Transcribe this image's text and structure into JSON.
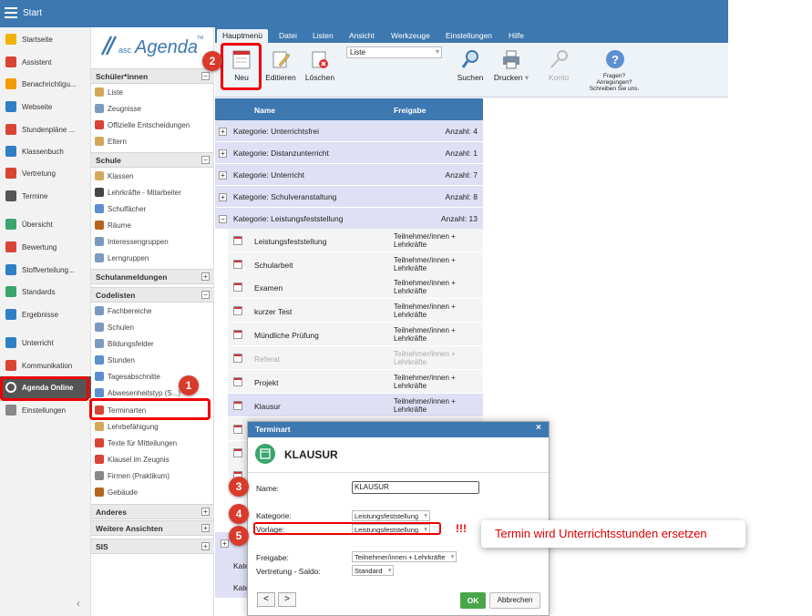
{
  "app": {
    "title": "Start"
  },
  "left_nav": [
    {
      "label": "Startseite",
      "color": "#f3b200"
    },
    {
      "label": "Assistent",
      "color": "#d94435"
    },
    {
      "label": "Benachrichtigu...",
      "color": "#f29a00"
    },
    {
      "label": "Webseite",
      "color": "#2f7fc4"
    },
    {
      "label": "Stundenpläne ...",
      "color": "#d94435"
    },
    {
      "label": "Klassenbuch",
      "color": "#2f7fc4"
    },
    {
      "label": "Vertretung",
      "color": "#d94435"
    },
    {
      "label": "Termine",
      "color": "#555555"
    },
    {
      "label": "Übersicht",
      "color": "#3aa56d"
    },
    {
      "label": "Bewertung",
      "color": "#d94435"
    },
    {
      "label": "Stoffverteilung...",
      "color": "#2f7fc4"
    },
    {
      "label": "Standards",
      "color": "#3aa56d"
    },
    {
      "label": "Ergebnisse",
      "color": "#2f7fc4"
    },
    {
      "label": "Unterricht",
      "color": "#2f7fc4"
    },
    {
      "label": "Kommunikation",
      "color": "#d94435"
    },
    {
      "label": "Agenda Online",
      "color": "#ffffff"
    },
    {
      "label": "Einstellungen",
      "color": "#888888"
    }
  ],
  "logo": {
    "text_small": "asc",
    "text_big": "Agenda",
    "tm": "TM"
  },
  "mid_nav": {
    "sections": [
      {
        "label": "Schüler*innen",
        "toggle": "⊟"
      },
      {
        "label": "Schule",
        "toggle": "⊟"
      },
      {
        "label": "Schulanmeldungen",
        "toggle": "⊞"
      },
      {
        "label": "Codelisten",
        "toggle": "⊟"
      },
      {
        "label": "Anderes",
        "toggle": "⊞"
      },
      {
        "label": "Weitere Ansichten",
        "toggle": "⊞"
      },
      {
        "label": "SIS",
        "toggle": "⊞"
      }
    ],
    "items": [
      "Liste",
      "Zeugnisse",
      "Offizielle Entscheidungen",
      "Eltern",
      "Klassen",
      "Lehrkräfte - Mitarbeiter",
      "Schulfächer",
      "Räume",
      "Interessengruppen",
      "Lerngruppen",
      "Fachbereiche",
      "Schulen",
      "Bildungsfelder",
      "Stunden",
      "Tagesabschnitte",
      "Abwesenheitstyp (S...)",
      "Terminarten",
      "Lehrbefähigung",
      "Texte für Mitteilungen",
      "Klausel im Zeugnis",
      "Firmen (Praktikum)",
      "Gebäude"
    ]
  },
  "menu": [
    "Hauptmenü",
    "Datei",
    "Listen",
    "Ansicht",
    "Werkzeuge",
    "Einstellungen",
    "Hilfe"
  ],
  "toolbar": {
    "neu": "Neu",
    "edit": "Editieren",
    "delete": "Löschen",
    "view_select": "Liste",
    "search": "Suchen",
    "print": "Drucken",
    "account": "Konto",
    "help1": "Fragen?",
    "help2": "Anregungen?",
    "help3": "Schreiben Sie uns."
  },
  "grid": {
    "col_name": "Name",
    "col_freigabe": "Freigabe",
    "categories": [
      {
        "name": "Kategorie: Unterrichtsfrei",
        "count": "Anzahl: 4",
        "ex": "+"
      },
      {
        "name": "Kategorie: Distanzunterricht",
        "count": "Anzahl: 1",
        "ex": "+"
      },
      {
        "name": "Kategorie: Unterricht",
        "count": "Anzahl: 7",
        "ex": "+"
      },
      {
        "name": "Kategorie: Schulveranstaltung",
        "count": "Anzahl: 8",
        "ex": "+"
      },
      {
        "name": "Kategorie: Leistungsfeststellung",
        "count": "Anzahl: 13",
        "ex": "−"
      }
    ],
    "rows": [
      {
        "name": "Leistungsfeststellung",
        "f1": "Teilnehmer/innen +",
        "f2": "Lehrkräfte"
      },
      {
        "name": "Schularbeit",
        "f1": "Teilnehmer/innen +",
        "f2": "Lehrkräfte"
      },
      {
        "name": "Examen",
        "f1": "Teilnehmer/innen +",
        "f2": "Lehrkräfte"
      },
      {
        "name": "kurzer Test",
        "f1": "Teilnehmer/innen +",
        "f2": "Lehrkräfte"
      },
      {
        "name": "Mündliche Prüfung",
        "f1": "Teilnehmer/innen +",
        "f2": "Lehrkräfte"
      },
      {
        "name": "Referat",
        "f1": "Teilnehmer/innen +",
        "f2": "Lehrkräfte"
      },
      {
        "name": "Projekt",
        "f1": "Teilnehmer/innen +",
        "f2": "Lehrkräfte"
      },
      {
        "name": "Klausur",
        "f1": "Teilnehmer/innen +",
        "f2": "Lehrkräfte"
      }
    ],
    "lower_cats": [
      "+",
      "Kate",
      "Kate"
    ]
  },
  "dialog": {
    "header": "Terminart",
    "close": "×",
    "title": "KLAUSUR",
    "name_label": "Name:",
    "name_value": "KLAUSUR",
    "kategorie_label": "Kategorie:",
    "kategorie_value": "Leistungsfeststellung",
    "vorlage_label": "Vorlage:",
    "vorlage_value": "Leistungsfeststellung",
    "freigabe_label": "Freigabe:",
    "freigabe_value": "Teilnehmer/innen + Lehrkräfte",
    "saldo_label": "Vertretung - Saldo:",
    "saldo_value": "Standard",
    "prev": "<",
    "next": ">",
    "ok": "OK",
    "cancel": "Abbrechen"
  },
  "annotations": {
    "b1": "1",
    "b2": "2",
    "b3": "3",
    "b4": "4",
    "b5": "5",
    "bang": "!!!",
    "note": "Termin wird Unterrichtsstunden ersetzen"
  }
}
